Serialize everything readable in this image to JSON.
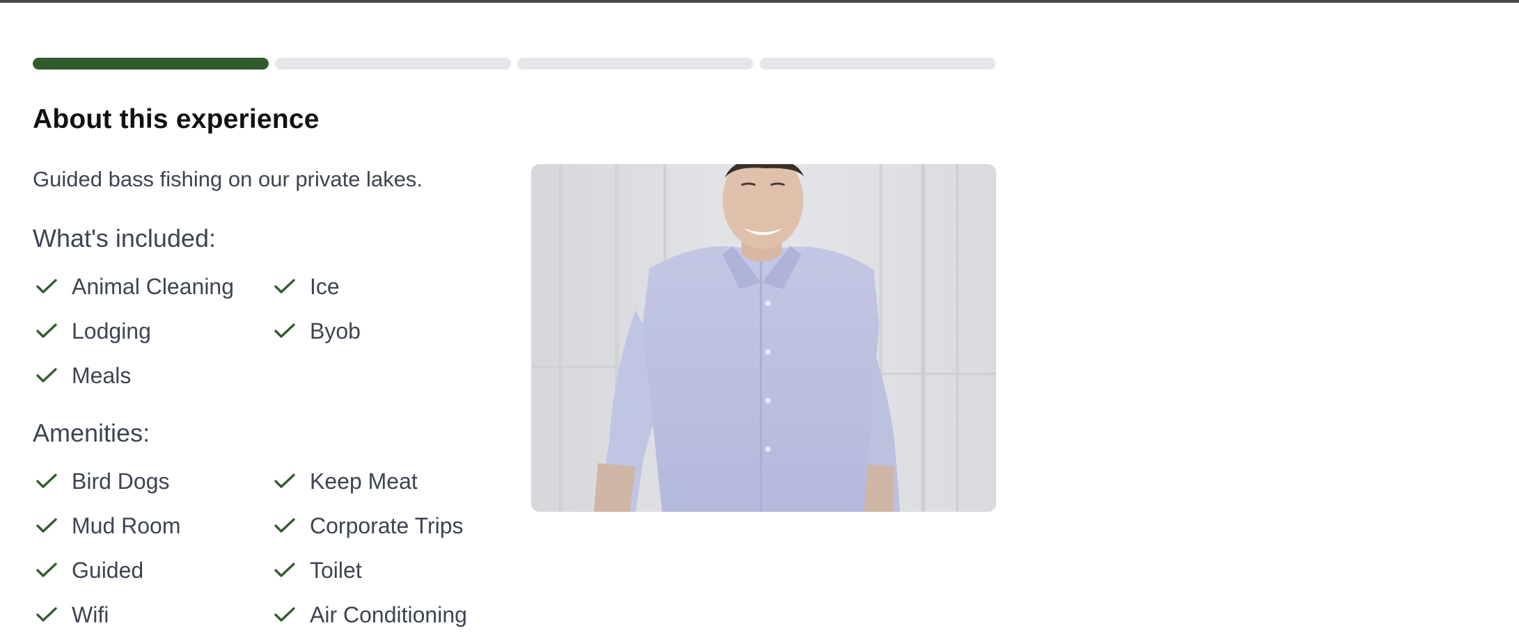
{
  "experience": {
    "heading": "About this experience",
    "description": "Guided bass fishing on our private lakes.",
    "progress": {
      "total_steps": 4,
      "current_step": 1,
      "accent_color": "#325c2e",
      "track_color": "#e6e6ea"
    },
    "included": {
      "title": "What's included:",
      "items": [
        {
          "label": "Animal Cleaning",
          "icon": "checkmark-icon"
        },
        {
          "label": "Ice",
          "icon": "checkmark-icon"
        },
        {
          "label": "Lodging",
          "icon": "checkmark-icon"
        },
        {
          "label": "Byob",
          "icon": "checkmark-icon"
        },
        {
          "label": "Meals",
          "icon": "checkmark-icon"
        }
      ]
    },
    "amenities": {
      "title": "Amenities:",
      "items": [
        {
          "label": "Bird Dogs",
          "icon": "checkmark-icon"
        },
        {
          "label": "Keep Meat",
          "icon": "checkmark-icon"
        },
        {
          "label": "Mud Room",
          "icon": "checkmark-icon"
        },
        {
          "label": "Corporate Trips",
          "icon": "checkmark-icon"
        },
        {
          "label": "Guided",
          "icon": "checkmark-icon"
        },
        {
          "label": "Toilet",
          "icon": "checkmark-icon"
        },
        {
          "label": "Wifi",
          "icon": "checkmark-icon"
        },
        {
          "label": "Air Conditioning",
          "icon": "checkmark-icon"
        }
      ]
    },
    "photo": {
      "subject": "smiling man in light blue button-down shirt"
    },
    "colors": {
      "check": "#325c2e",
      "text": "#3d4451",
      "heading": "#111111"
    }
  }
}
